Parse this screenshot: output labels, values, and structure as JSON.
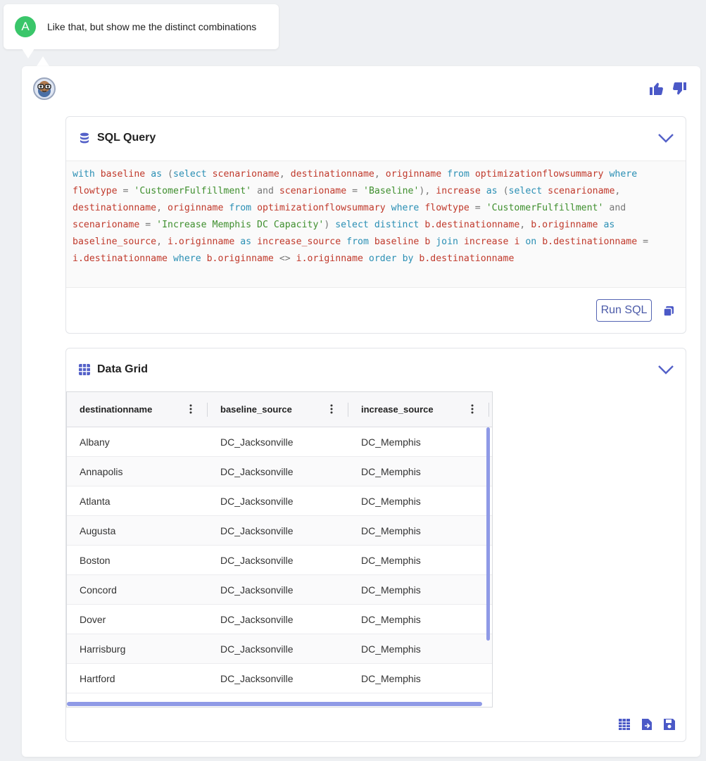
{
  "user_message": {
    "avatar_letter": "A",
    "text": "Like that, but show me the distinct combinations"
  },
  "feedback": {
    "like_icon": "thumbs-up-icon",
    "dislike_icon": "thumbs-down-icon"
  },
  "sql_card": {
    "title": "SQL Query",
    "icon": "database-icon",
    "query_tokens": [
      [
        "kw",
        "with"
      ],
      [
        " ",
        ""
      ],
      [
        "id",
        "baseline"
      ],
      [
        " ",
        ""
      ],
      [
        "kw",
        "as"
      ],
      [
        " ",
        ""
      ],
      [
        "op",
        "("
      ],
      [
        "kw",
        "select"
      ],
      [
        " ",
        ""
      ],
      [
        "id",
        "scenarioname"
      ],
      [
        "op",
        ","
      ],
      [
        " ",
        ""
      ],
      [
        "id",
        "destinationname"
      ],
      [
        "op",
        ","
      ],
      [
        " ",
        ""
      ],
      [
        "id",
        "originname"
      ],
      [
        " ",
        ""
      ],
      [
        "kw",
        "from"
      ],
      [
        " ",
        ""
      ],
      [
        "id",
        "optimizationflowsummary"
      ],
      [
        " ",
        ""
      ],
      [
        "kw",
        "where"
      ],
      [
        " ",
        ""
      ],
      [
        "id",
        "flowtype"
      ],
      [
        " ",
        ""
      ],
      [
        "op",
        "="
      ],
      [
        " ",
        ""
      ],
      [
        "str",
        "'CustomerFulfillment'"
      ],
      [
        " ",
        ""
      ],
      [
        "op",
        "and"
      ],
      [
        " ",
        ""
      ],
      [
        "id",
        "scenarioname"
      ],
      [
        " ",
        ""
      ],
      [
        "op",
        "="
      ],
      [
        " ",
        ""
      ],
      [
        "str",
        "'Baseline'"
      ],
      [
        "op",
        "),"
      ],
      [
        " ",
        ""
      ],
      [
        "id",
        "increase"
      ],
      [
        " ",
        ""
      ],
      [
        "kw",
        "as"
      ],
      [
        " ",
        ""
      ],
      [
        "op",
        "("
      ],
      [
        "kw",
        "select"
      ],
      [
        " ",
        ""
      ],
      [
        "id",
        "scenarioname"
      ],
      [
        "op",
        ","
      ],
      [
        " ",
        ""
      ],
      [
        "id",
        "destinationname"
      ],
      [
        "op",
        ","
      ],
      [
        " ",
        ""
      ],
      [
        "id",
        "originname"
      ],
      [
        " ",
        ""
      ],
      [
        "kw",
        "from"
      ],
      [
        " ",
        ""
      ],
      [
        "id",
        "optimizationflowsummary"
      ],
      [
        " ",
        ""
      ],
      [
        "kw",
        "where"
      ],
      [
        " ",
        ""
      ],
      [
        "id",
        "flowtype"
      ],
      [
        " ",
        ""
      ],
      [
        "op",
        "="
      ],
      [
        " ",
        ""
      ],
      [
        "str",
        "'CustomerFulfillment'"
      ],
      [
        " ",
        ""
      ],
      [
        "op",
        "and"
      ],
      [
        " ",
        ""
      ],
      [
        "id",
        "scenarioname"
      ],
      [
        " ",
        ""
      ],
      [
        "op",
        "="
      ],
      [
        " ",
        ""
      ],
      [
        "str",
        "'Increase Memphis DC Capacity'"
      ],
      [
        "op",
        ")"
      ],
      [
        " ",
        ""
      ],
      [
        "kw",
        "select"
      ],
      [
        " ",
        ""
      ],
      [
        "kw",
        "distinct"
      ],
      [
        " ",
        ""
      ],
      [
        "id",
        "b.destinationname"
      ],
      [
        "op",
        ","
      ],
      [
        " ",
        ""
      ],
      [
        "id",
        "b.originname"
      ],
      [
        " ",
        ""
      ],
      [
        "kw",
        "as"
      ],
      [
        " ",
        ""
      ],
      [
        "id",
        "baseline_source"
      ],
      [
        "op",
        ","
      ],
      [
        " ",
        ""
      ],
      [
        "id",
        "i.originname"
      ],
      [
        " ",
        ""
      ],
      [
        "kw",
        "as"
      ],
      [
        " ",
        ""
      ],
      [
        "id",
        "increase_source"
      ],
      [
        " ",
        ""
      ],
      [
        "kw",
        "from"
      ],
      [
        " ",
        ""
      ],
      [
        "id",
        "baseline"
      ],
      [
        " ",
        ""
      ],
      [
        "id",
        "b"
      ],
      [
        " ",
        ""
      ],
      [
        "kw",
        "join"
      ],
      [
        " ",
        ""
      ],
      [
        "id",
        "increase"
      ],
      [
        " ",
        ""
      ],
      [
        "id",
        "i"
      ],
      [
        " ",
        ""
      ],
      [
        "kw",
        "on"
      ],
      [
        " ",
        ""
      ],
      [
        "id",
        "b.destinationname"
      ],
      [
        " ",
        ""
      ],
      [
        "op",
        "="
      ],
      [
        " ",
        ""
      ],
      [
        "id",
        "i.destinationname"
      ],
      [
        " ",
        ""
      ],
      [
        "kw",
        "where"
      ],
      [
        " ",
        ""
      ],
      [
        "id",
        "b.originname"
      ],
      [
        " ",
        ""
      ],
      [
        "op",
        "<>"
      ],
      [
        " ",
        ""
      ],
      [
        "id",
        "i.originname"
      ],
      [
        " ",
        ""
      ],
      [
        "kw",
        "order"
      ],
      [
        " ",
        ""
      ],
      [
        "kw",
        "by"
      ],
      [
        " ",
        ""
      ],
      [
        "id",
        "b.destinationname"
      ]
    ],
    "run_label": "Run SQL",
    "copy_icon": "copy-icon",
    "collapse_icon": "chevron-down-icon"
  },
  "grid_card": {
    "title": "Data Grid",
    "icon": "grid-icon",
    "columns": [
      "destinationname",
      "baseline_source",
      "increase_source"
    ],
    "rows": [
      [
        "Albany",
        "DC_Jacksonville",
        "DC_Memphis"
      ],
      [
        "Annapolis",
        "DC_Jacksonville",
        "DC_Memphis"
      ],
      [
        "Atlanta",
        "DC_Jacksonville",
        "DC_Memphis"
      ],
      [
        "Augusta",
        "DC_Jacksonville",
        "DC_Memphis"
      ],
      [
        "Boston",
        "DC_Jacksonville",
        "DC_Memphis"
      ],
      [
        "Concord",
        "DC_Jacksonville",
        "DC_Memphis"
      ],
      [
        "Dover",
        "DC_Jacksonville",
        "DC_Memphis"
      ],
      [
        "Harrisburg",
        "DC_Jacksonville",
        "DC_Memphis"
      ],
      [
        "Hartford",
        "DC_Jacksonville",
        "DC_Memphis"
      ]
    ],
    "actions": [
      "table-view-icon",
      "export-icon",
      "save-icon"
    ]
  },
  "colors": {
    "accent": "#5461c8",
    "user_avatar": "#3ac66a"
  }
}
